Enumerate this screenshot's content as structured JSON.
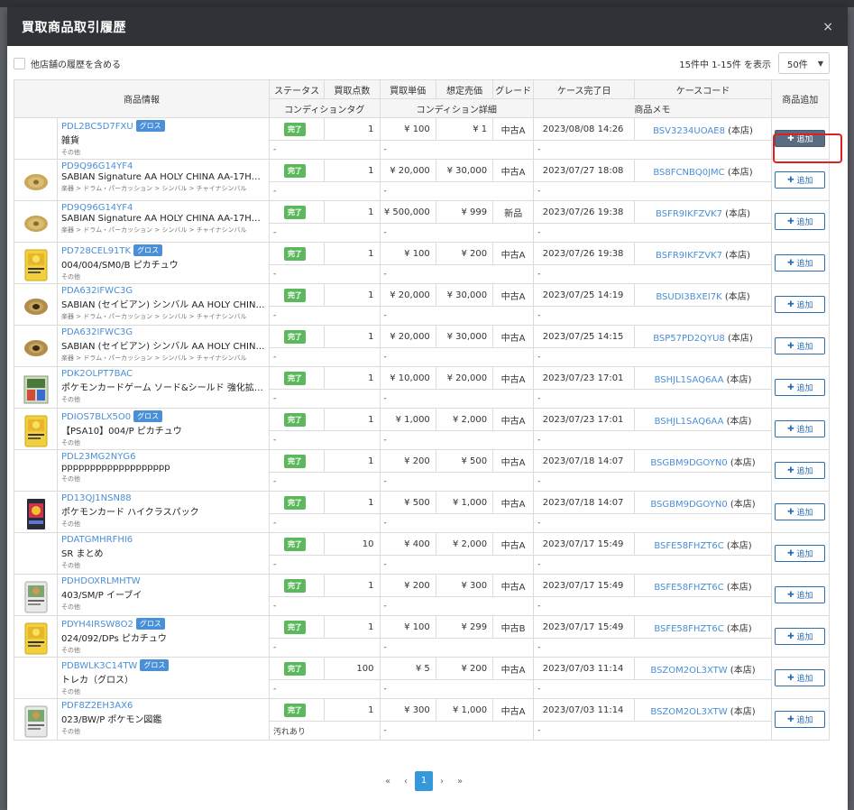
{
  "modal": {
    "title": "買取商品取引履歴",
    "close": "×"
  },
  "toolbar": {
    "include_other_stores": "他店舗の履歴を含める",
    "range_text": "15件中 1-15件 を表示",
    "per_page": "50件"
  },
  "columns": {
    "product_info": "商品情報",
    "status": "ステータス",
    "qty": "買取点数",
    "unit_price": "買取単価",
    "expected_price": "想定売価",
    "grade": "グレード",
    "case_done": "ケース完了日",
    "case_code": "ケースコード",
    "add": "商品追加",
    "condition_tag": "コンディションタグ",
    "condition_detail": "コンディション詳細",
    "memo": "商品メモ"
  },
  "add_label": "追加",
  "rows": [
    {
      "code": "PDL2BC5D7FXU",
      "gross": "グロス",
      "name": "雑貨",
      "cat": "その他",
      "status": "完了",
      "qty": "1",
      "unit": "¥ 100",
      "exp": "¥ 1",
      "grade": "中古A",
      "date": "2023/08/08 14:26",
      "case": "BSV3234UOAE8",
      "store": " (本店)",
      "tag": "-",
      "detail": "-",
      "memo": "-",
      "thumb": "none"
    },
    {
      "code": "PD9Q96G14YF4",
      "gross": "",
      "name": "SABIAN Signature AA HOLY CHINA AA-17HC...",
      "cat": "楽器 > ドラム・パーカッション > シンバル > チャイナシンバル",
      "status": "完了",
      "qty": "1",
      "unit": "¥ 20,000",
      "exp": "¥ 30,000",
      "grade": "中古A",
      "date": "2023/07/27 18:08",
      "case": "BS8FCNBQ0JMC",
      "store": " (本店)",
      "tag": "-",
      "detail": "-",
      "memo": "-",
      "thumb": "cymbal"
    },
    {
      "code": "PD9Q96G14YF4",
      "gross": "",
      "name": "SABIAN Signature AA HOLY CHINA AA-17HC...",
      "cat": "楽器 > ドラム・パーカッション > シンバル > チャイナシンバル",
      "status": "完了",
      "qty": "1",
      "unit": "¥ 500,000",
      "exp": "¥ 999",
      "grade": "新品",
      "date": "2023/07/26 19:38",
      "case": "BSFR9IKFZVK7",
      "store": " (本店)",
      "tag": "-",
      "detail": "-",
      "memo": "-",
      "thumb": "cymbal"
    },
    {
      "code": "PD728CEL91TK",
      "gross": "グロス",
      "name": "004/004/SM0/B ピカチュウ",
      "cat": "その他",
      "status": "完了",
      "qty": "1",
      "unit": "¥ 100",
      "exp": "¥ 200",
      "grade": "中古A",
      "date": "2023/07/26 19:38",
      "case": "BSFR9IKFZVK7",
      "store": " (本店)",
      "tag": "-",
      "detail": "-",
      "memo": "-",
      "thumb": "card-yellow"
    },
    {
      "code": "PDA632IFWC3G",
      "gross": "",
      "name": "SABIAN (セイビアン) シンバル AA HOLY CHINA 1...",
      "cat": "楽器 > ドラム・パーカッション > シンバル > チャイナシンバル",
      "status": "完了",
      "qty": "1",
      "unit": "¥ 20,000",
      "exp": "¥ 30,000",
      "grade": "中古A",
      "date": "2023/07/25 14:19",
      "case": "BSUDI3BXEI7K",
      "store": " (本店)",
      "tag": "-",
      "detail": "-",
      "memo": "-",
      "thumb": "cymbal-dark"
    },
    {
      "code": "PDA632IFWC3G",
      "gross": "",
      "name": "SABIAN (セイビアン) シンバル AA HOLY CHINA 1...",
      "cat": "楽器 > ドラム・パーカッション > シンバル > チャイナシンバル",
      "status": "完了",
      "qty": "1",
      "unit": "¥ 20,000",
      "exp": "¥ 30,000",
      "grade": "中古A",
      "date": "2023/07/25 14:15",
      "case": "BSP57PD2QYU8",
      "store": " (本店)",
      "tag": "-",
      "detail": "-",
      "memo": "-",
      "thumb": "cymbal-dark"
    },
    {
      "code": "PDK2OLPT7BAC",
      "gross": "",
      "name": "ポケモンカードゲーム ソード&シールド 強化拡張パック...",
      "cat": "その他",
      "status": "完了",
      "qty": "1",
      "unit": "¥ 10,000",
      "exp": "¥ 20,000",
      "grade": "中古A",
      "date": "2023/07/23 17:01",
      "case": "BSHJL1SAQ6AA",
      "store": " (本店)",
      "tag": "-",
      "detail": "-",
      "memo": "-",
      "thumb": "box"
    },
    {
      "code": "PDIOS7BLX5O0",
      "gross": "グロス",
      "name": "【PSA10】004/P ピカチュウ",
      "cat": "その他",
      "status": "完了",
      "qty": "1",
      "unit": "¥ 1,000",
      "exp": "¥ 2,000",
      "grade": "中古A",
      "date": "2023/07/23 17:01",
      "case": "BSHJL1SAQ6AA",
      "store": " (本店)",
      "tag": "-",
      "detail": "-",
      "memo": "-",
      "thumb": "card-yellow"
    },
    {
      "code": "PDL23MG2NYG6",
      "gross": "",
      "name": "ppppppppppppppppppp",
      "cat": "その他",
      "status": "完了",
      "qty": "1",
      "unit": "¥ 200",
      "exp": "¥ 500",
      "grade": "中古A",
      "date": "2023/07/18 14:07",
      "case": "BSGBM9DGOYN0",
      "store": " (本店)",
      "tag": "-",
      "detail": "-",
      "memo": "-",
      "thumb": "none"
    },
    {
      "code": "PD13QJ1NSN88",
      "gross": "",
      "name": "ポケモンカード ハイクラスパック",
      "cat": "その他",
      "status": "完了",
      "qty": "1",
      "unit": "¥ 500",
      "exp": "¥ 1,000",
      "grade": "中古A",
      "date": "2023/07/18 14:07",
      "case": "BSGBM9DGOYN0",
      "store": " (本店)",
      "tag": "-",
      "detail": "-",
      "memo": "-",
      "thumb": "pack"
    },
    {
      "code": "PDATGMHRFHI6",
      "gross": "",
      "name": "SR まとめ",
      "cat": "その他",
      "status": "完了",
      "qty": "10",
      "unit": "¥ 400",
      "exp": "¥ 2,000",
      "grade": "中古A",
      "date": "2023/07/17 15:49",
      "case": "BSFE58FHZT6C",
      "store": " (本店)",
      "tag": "-",
      "detail": "-",
      "memo": "-",
      "thumb": "none"
    },
    {
      "code": "PDHDOXRLMHTW",
      "gross": "",
      "name": "403/SM/P イーブイ",
      "cat": "その他",
      "status": "完了",
      "qty": "1",
      "unit": "¥ 200",
      "exp": "¥ 300",
      "grade": "中古A",
      "date": "2023/07/17 15:49",
      "case": "BSFE58FHZT6C",
      "store": " (本店)",
      "tag": "-",
      "detail": "-",
      "memo": "-",
      "thumb": "card-white"
    },
    {
      "code": "PDYH4IRSW8O2",
      "gross": "グロス",
      "name": "024/092/DPs ピカチュウ",
      "cat": "その他",
      "status": "完了",
      "qty": "1",
      "unit": "¥ 100",
      "exp": "¥ 299",
      "grade": "中古B",
      "date": "2023/07/17 15:49",
      "case": "BSFE58FHZT6C",
      "store": " (本店)",
      "tag": "-",
      "detail": "-",
      "memo": "-",
      "thumb": "card-yellow"
    },
    {
      "code": "PDBWLK3C14TW",
      "gross": "グロス",
      "name": "トレカ（グロス）",
      "cat": "その他",
      "status": "完了",
      "qty": "100",
      "unit": "¥ 5",
      "exp": "¥ 200",
      "grade": "中古A",
      "date": "2023/07/03 11:14",
      "case": "BSZOM2OL3XTW",
      "store": " (本店)",
      "tag": "-",
      "detail": "-",
      "memo": "-",
      "thumb": "none"
    },
    {
      "code": "PDF8Z2EH3AX6",
      "gross": "",
      "name": "023/BW/P ポケモン図鑑",
      "cat": "その他",
      "status": "完了",
      "qty": "1",
      "unit": "¥ 300",
      "exp": "¥ 1,000",
      "grade": "中古A",
      "date": "2023/07/03 11:14",
      "case": "BSZOM2OL3XTW",
      "store": " (本店)",
      "tag": "汚れあり",
      "detail": "-",
      "memo": "-",
      "thumb": "card-white"
    }
  ],
  "pagination": {
    "first": "«",
    "prev": "‹",
    "current": "1",
    "next": "›",
    "last": "»"
  }
}
